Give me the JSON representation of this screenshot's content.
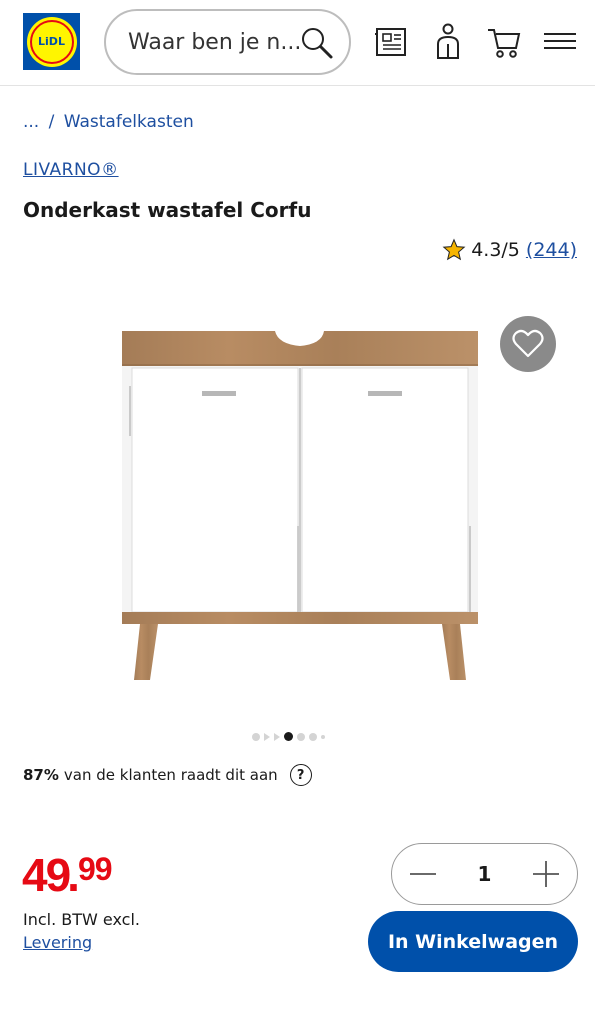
{
  "header": {
    "logo_text": "LiDL",
    "search": {
      "placeholder": "Waar ben je n..."
    },
    "icons": [
      "search-icon",
      "leaflet-icon",
      "account-icon",
      "cart-icon",
      "menu-icon"
    ]
  },
  "breadcrumb": {
    "ellipsis": "...",
    "separator": "/",
    "current": "Wastafelkasten"
  },
  "product": {
    "brand": "LIVARNO®",
    "title": "Onderkast wastafel Corfu",
    "rating": {
      "score": "4.3/5",
      "count": "(244)",
      "value": 4.3
    },
    "image_dots": {
      "total": 7,
      "active_index": 3
    },
    "recommendation": {
      "percent": "87%",
      "text": "van de klanten raadt dit aan",
      "help": "?"
    }
  },
  "pricing": {
    "integer": "49",
    "separator": ".",
    "decimals": "99",
    "vat": "Incl. BTW excl.",
    "delivery": "Levering"
  },
  "purchase": {
    "quantity": "1",
    "add_to_cart": "In Winkelwagen"
  },
  "colors": {
    "brand_blue": "#0050aa",
    "price_red": "#e60a14",
    "link_blue": "#1e4fa0",
    "logo_yellow": "#fff500"
  }
}
